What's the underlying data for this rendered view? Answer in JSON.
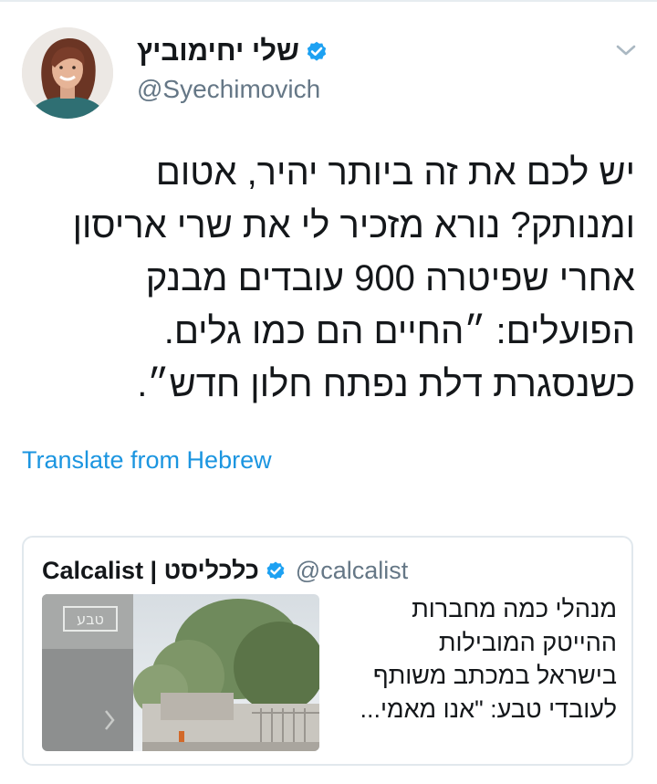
{
  "tweet": {
    "display_name": "שלי יחימוביץ",
    "handle": "@Syechimovich",
    "verified": true,
    "avatar_icon": "profile-photo",
    "menu_icon": "chevron-down-icon",
    "text_lines": [
      "יש לכם את זה ביותר יהיר, אטום",
      "ומנותק? נורא מזכיר לי את שרי אריסון",
      "אחרי שפיטרה 900 עובדים מבנק",
      "הפועלים: ״החיים הם כמו גלים.",
      "כשנסגרת דלת נפתח חלון חדש״."
    ],
    "translate_label": "Translate from Hebrew"
  },
  "quoted_tweet": {
    "display_name": "Calcalist | כלכליסט",
    "handle": "@calcalist",
    "verified": true,
    "text_lines": [
      "מנהלי כמה מחברות",
      "ההייטק המובילות",
      "בישראל במכתב משותף",
      "לעובדי טבע: \"אנו מאמי..."
    ],
    "image_sign_text": "טבע"
  },
  "colors": {
    "link": "#1b95e0",
    "verified": "#1da1f2",
    "secondary_text": "#657786",
    "border": "#e1e8ed"
  }
}
